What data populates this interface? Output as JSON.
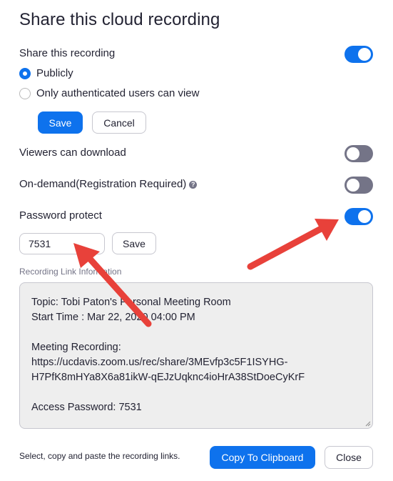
{
  "dialog": {
    "title": "Share this cloud recording"
  },
  "share_recording": {
    "label": "Share this recording",
    "enabled": true,
    "options": [
      {
        "label": "Publicly",
        "selected": true
      },
      {
        "label": "Only authenticated users can view",
        "selected": false
      }
    ],
    "save_label": "Save",
    "cancel_label": "Cancel"
  },
  "viewers_download": {
    "label": "Viewers can download",
    "enabled": false
  },
  "on_demand": {
    "label": "On-demand(Registration Required)",
    "help_glyph": "?",
    "enabled": false
  },
  "password_protect": {
    "label": "Password protect",
    "enabled": true,
    "value": "7531",
    "save_label": "Save"
  },
  "link_info": {
    "section_label": "Recording Link Information",
    "topic": "Topic: Tobi Paton's Personal Meeting Room",
    "start_time": "Start Time : Mar 22, 2020 04:00 PM",
    "recording_heading": "Meeting Recording:",
    "url_line1": "https://ucdavis.zoom.us/rec/share/3MEvfp3c5F1ISYHG-",
    "url_line2": "H7PfK8mHYa8X6a81ikW-qEJzUqknc4ioHrA38StDoeCyKrF",
    "access_password": "Access Password: 7531"
  },
  "footer": {
    "hint": "Select, copy and paste the recording links.",
    "copy_label": "Copy To Clipboard",
    "close_label": "Close"
  },
  "colors": {
    "accent": "#0e72ed",
    "toggle_off": "#747487",
    "annotation_arrow": "#e8413a",
    "info_box_bg": "#eeeeee"
  }
}
